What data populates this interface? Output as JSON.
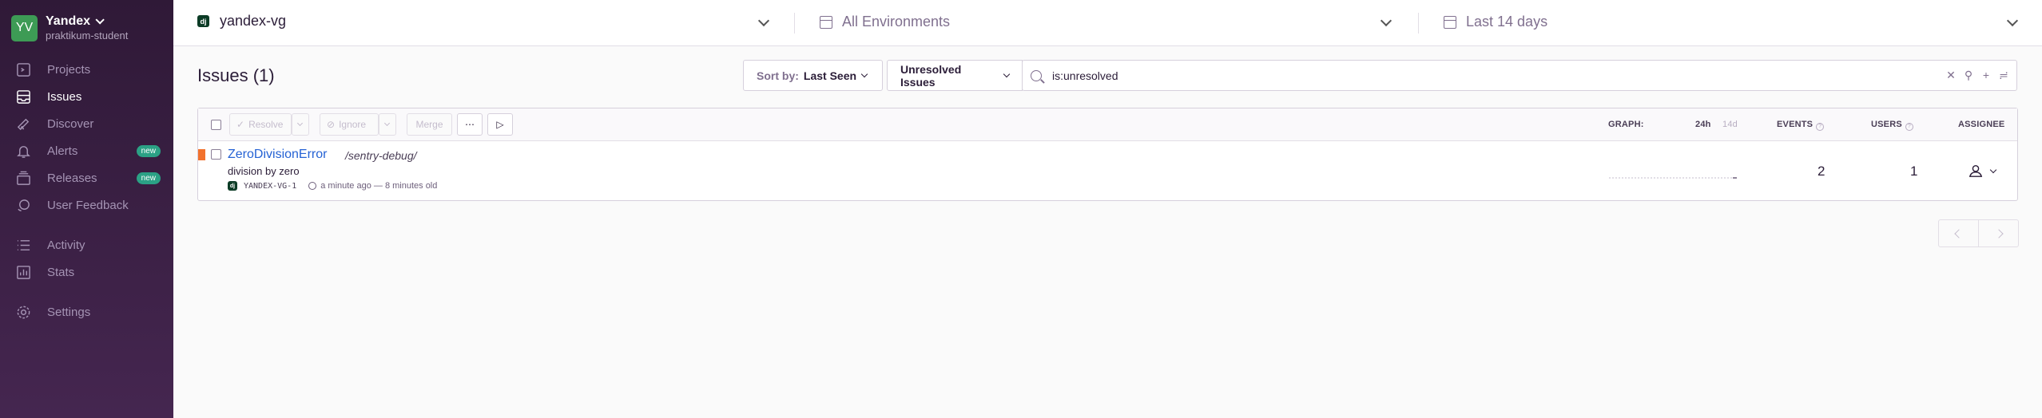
{
  "org": {
    "avatar": "YV",
    "name": "Yandex",
    "user": "praktikum-student"
  },
  "sidebar": {
    "items": [
      {
        "label": "Projects",
        "icon": "projects-icon"
      },
      {
        "label": "Issues",
        "icon": "issues-icon",
        "active": true
      },
      {
        "label": "Discover",
        "icon": "discover-icon"
      },
      {
        "label": "Alerts",
        "icon": "alerts-icon",
        "badge": "new"
      },
      {
        "label": "Releases",
        "icon": "releases-icon",
        "badge": "new"
      },
      {
        "label": "User Feedback",
        "icon": "user-feedback-icon"
      },
      {
        "label": "Activity",
        "icon": "activity-icon"
      },
      {
        "label": "Stats",
        "icon": "stats-icon"
      },
      {
        "label": "Settings",
        "icon": "settings-icon"
      }
    ]
  },
  "header": {
    "project": "yandex-vg",
    "project_badge": "dj",
    "environment": "All Environments",
    "date_range": "Last 14 days"
  },
  "main": {
    "title": "Issues (1)",
    "sort_label": "Sort by:",
    "sort_value": "Last Seen",
    "saved_search": "Unresolved Issues",
    "search_query": "is:unresolved"
  },
  "toolbar": {
    "resolve": "Resolve",
    "ignore": "Ignore",
    "merge": "Merge",
    "more": "⋯",
    "play": "▷",
    "graph": "GRAPH:",
    "graph_24h": "24h",
    "graph_14d": "14d",
    "events": "EVENTS",
    "users": "USERS",
    "assignee": "ASSIGNEE"
  },
  "issues": [
    {
      "title": "ZeroDivisionError",
      "culprit": "/sentry-debug/",
      "message": "division by zero",
      "short_id": "YANDEX-VG-1",
      "project_badge": "dj",
      "age": "a minute ago — 8 minutes old",
      "events": "2",
      "users": "1",
      "level_color": "#f2722d"
    }
  ]
}
